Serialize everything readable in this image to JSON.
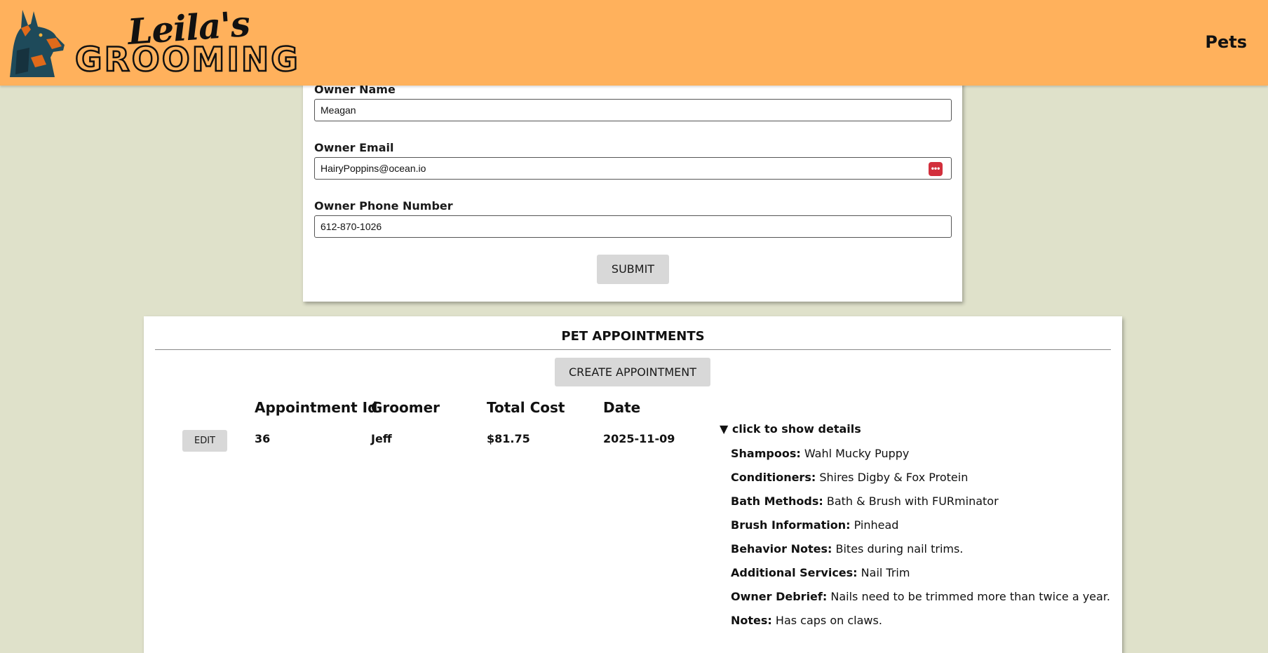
{
  "header": {
    "logo_script": "Leila's",
    "logo_word": "GROOMING",
    "nav_pets": "Pets"
  },
  "owner_form": {
    "name_label": "Owner Name",
    "name_value": "Meagan",
    "email_label": "Owner Email",
    "email_value": "HairyPoppins@ocean.io",
    "phone_label": "Owner Phone Number",
    "phone_value": "612-870-1026",
    "submit_label": "SUBMIT"
  },
  "appointments": {
    "title": "PET APPOINTMENTS",
    "create_label": "CREATE APPOINTMENT",
    "columns": [
      "Appointment Id",
      "Groomer",
      "Total Cost",
      "Date"
    ],
    "rows": [
      {
        "edit_label": "EDIT",
        "id": "36",
        "groomer": "Jeff",
        "total_cost": "$81.75",
        "date": "2025-11-09",
        "summary": "click to show details",
        "details": [
          {
            "key": "Shampoos:",
            "value": "Wahl Mucky Puppy"
          },
          {
            "key": "Conditioners:",
            "value": "Shires Digby & Fox Protein"
          },
          {
            "key": "Bath Methods:",
            "value": "Bath & Brush with FURminator"
          },
          {
            "key": "Brush Information:",
            "value": "Pinhead"
          },
          {
            "key": "Behavior Notes:",
            "value": "Bites during nail trims."
          },
          {
            "key": "Additional Services:",
            "value": "Nail Trim"
          },
          {
            "key": "Owner Debrief:",
            "value": "Nails need to be trimmed more than twice a year."
          },
          {
            "key": "Notes:",
            "value": "Has caps on claws."
          }
        ]
      }
    ]
  },
  "colors": {
    "header_bg": "#ffb15c",
    "page_bg": "#dfe1ca",
    "button_bg": "#d8d8d8",
    "password_icon": "#d22f3c"
  },
  "icons": [
    "doberman-logo-icon",
    "password-manager-icon",
    "disclosure-triangle-icon"
  ]
}
